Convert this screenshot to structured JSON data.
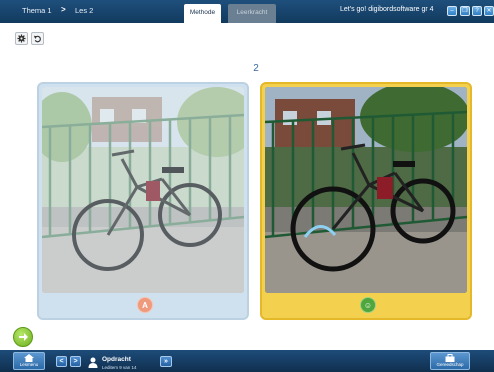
{
  "breadcrumb": {
    "theme": "Thema  1",
    "separator": ">",
    "lesson": "Les 2"
  },
  "tabs": [
    {
      "label": "Methode",
      "active": true
    },
    {
      "label": "Leerkracht",
      "active": false
    }
  ],
  "app_title": "Let's go! digibordsoftware gr 4",
  "window_controls": {
    "minimize": "–",
    "restore": "❐",
    "help": "?",
    "close": "✕"
  },
  "tools": {
    "settings_icon": "gear-icon",
    "undo_icon": "undo-icon"
  },
  "page_number": "2",
  "answers": [
    {
      "badge": "A",
      "image": "bicycle-photo",
      "state": "unselected"
    },
    {
      "badge": "☺",
      "image": "bicycle-photo",
      "state": "selected"
    }
  ],
  "next_button": {
    "icon": "arrow-right-icon"
  },
  "bottom": {
    "home_label": "Lesmenu",
    "prev_arrow": "<",
    "next_arrow": ">",
    "assignment_title": "Opdracht",
    "assignment_sub": "Leditem 9 van 14",
    "skip_arrow": "»",
    "tool_label": "Gereedschap"
  },
  "colors": {
    "bar_blue": "#1e4f7c",
    "selected_card": "#f3d04e",
    "unselected_card": "#cfe1ee",
    "accent_green": "#6cae1c"
  }
}
